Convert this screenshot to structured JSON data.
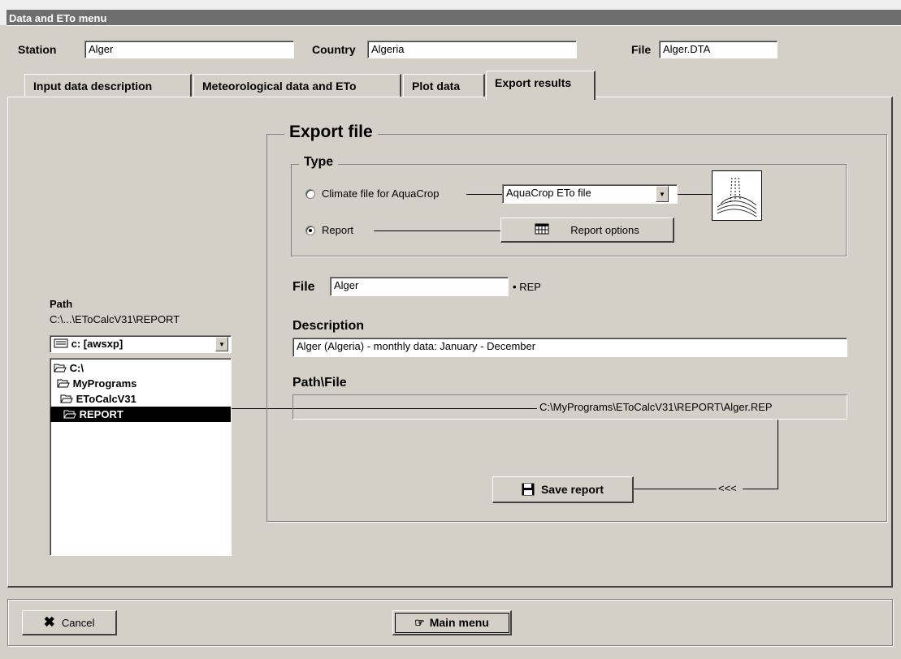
{
  "window": {
    "title": "Data and ETo menu"
  },
  "header": {
    "station_label": "Station",
    "station_value": "Alger",
    "country_label": "Country",
    "country_value": "Algeria",
    "file_label": "File",
    "file_value": "Alger.DTA"
  },
  "tabs": [
    {
      "label": "Input data description"
    },
    {
      "label": "Meteorological data and ETo"
    },
    {
      "label": "Plot data"
    },
    {
      "label": "Export results"
    }
  ],
  "path_panel": {
    "path_label": "Path",
    "path_value": "C:\\...\\EToCalcV31\\REPORT",
    "drive_value": "c: [awsxp]",
    "tree": [
      "C:\\",
      "MyPrograms",
      "EToCalcV31",
      "REPORT"
    ]
  },
  "export": {
    "group_title": "Export file",
    "type_title": "Type",
    "option_climate": "Climate file for AquaCrop",
    "climate_select_value": "AquaCrop ETo file",
    "option_report": "Report",
    "report_options_label": "Report options",
    "file_label": "File",
    "file_value": "Alger",
    "file_ext": "REP",
    "description_label": "Description",
    "description_value": "Alger (Algeria) - monthly data: January - December",
    "pathfile_label": "Path\\File",
    "pathfile_value": "C:\\MyPrograms\\EToCalcV31\\REPORT\\Alger.REP",
    "arrow_text": "<<<",
    "save_label": "Save report",
    "selected_option": "Report"
  },
  "footer": {
    "cancel_label": "Cancel",
    "main_menu_label": "Main menu"
  }
}
